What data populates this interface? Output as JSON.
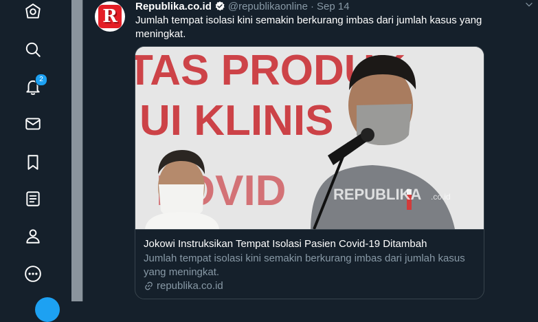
{
  "nav": {
    "items": [
      {
        "name": "explore-icon"
      },
      {
        "name": "search-icon"
      },
      {
        "name": "notifications-icon",
        "badge": "2"
      },
      {
        "name": "messages-icon"
      },
      {
        "name": "bookmarks-icon"
      },
      {
        "name": "lists-icon"
      },
      {
        "name": "profile-icon"
      },
      {
        "name": "more-icon"
      }
    ]
  },
  "tweet": {
    "display_name": "Republika.co.id",
    "handle": "@republikaonline",
    "separator": "·",
    "date": "Sep 14",
    "text": "Jumlah tempat isolasi kini semakin berkurang imbas dari jumlah kasus yang meningkat.",
    "avatar_letter": "R",
    "card": {
      "title": "Jokowi Instruksikan Tempat Isolasi Pasien Covid-19 Ditambah",
      "description": "Jumlah tempat isolasi kini semakin berkurang imbas dari jumlah kasus yang meningkat.",
      "domain": "republika.co.id",
      "image_text_line1": "TAS PRODUK",
      "image_text_line2": "UI KLINIS",
      "image_text_line3": "LOVID",
      "watermark": "REPUBLIKA",
      "watermark_suffix": ".co.id"
    }
  },
  "colors": {
    "background": "#15202b",
    "accent": "#1da1f2",
    "border": "#38444d",
    "muted": "#8899a6",
    "brand_red": "#e41e26"
  }
}
